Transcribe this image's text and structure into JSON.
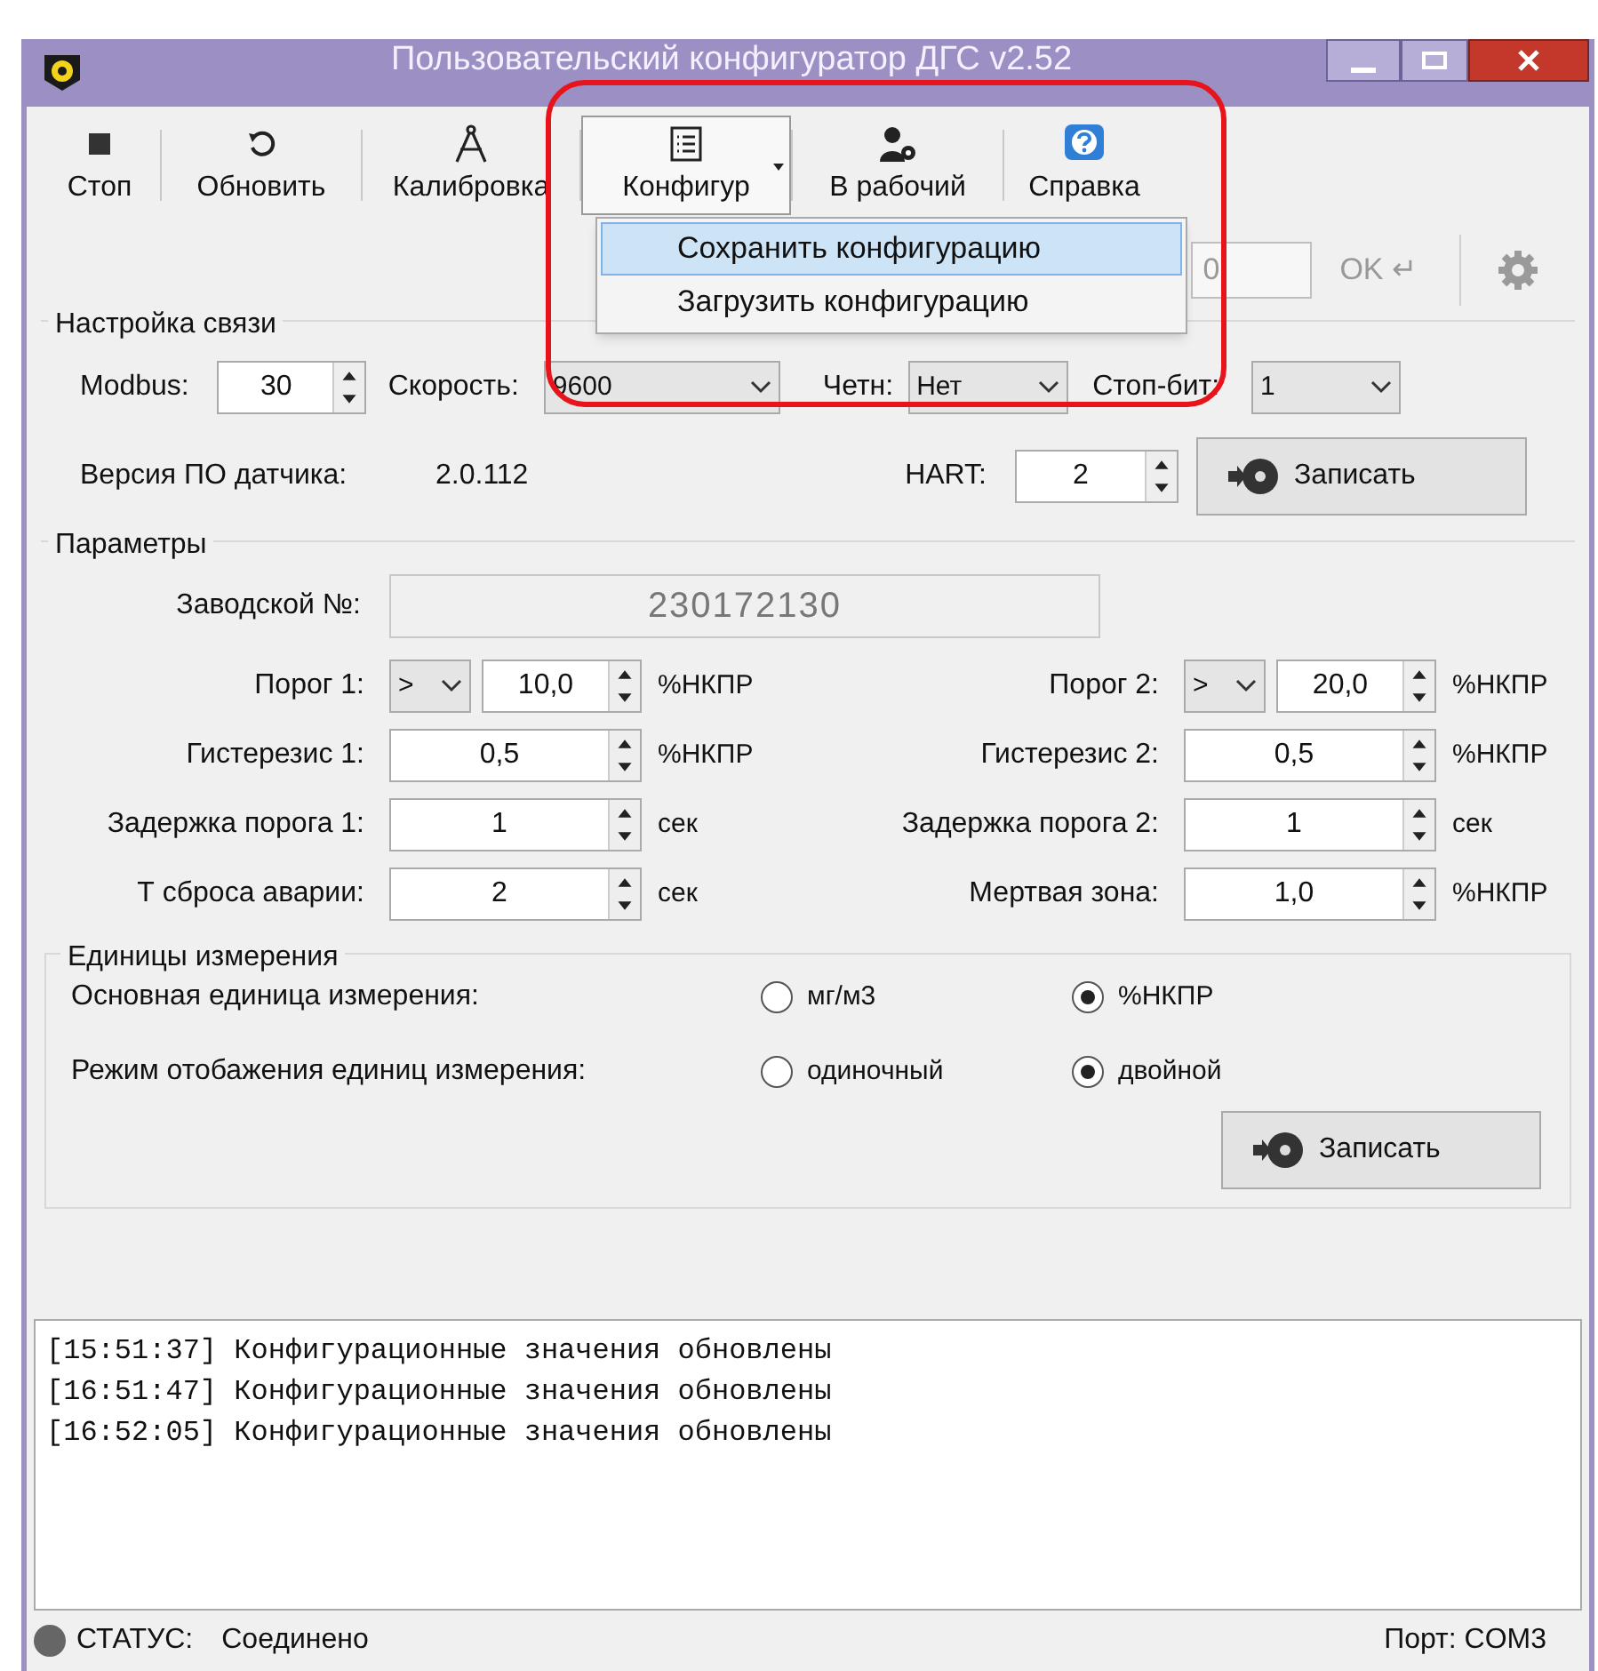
{
  "window": {
    "title": "Пользовательский конфигуратор ДГС v2.52"
  },
  "toolbar": [
    {
      "label": "Стоп",
      "selected": false
    },
    {
      "label": "Обновить",
      "selected": false
    },
    {
      "label": "Калибровка",
      "selected": false
    },
    {
      "label": "Конфигур",
      "selected": true,
      "dropdown": true
    },
    {
      "label": "В рабочий",
      "selected": false
    },
    {
      "label": "Справка",
      "selected": false
    }
  ],
  "config_menu": [
    {
      "label": "Сохранить конфигурацию",
      "selected": true
    },
    {
      "label": "Загрузить конфигурацию",
      "selected": false
    }
  ],
  "command_row": {
    "value": "0",
    "ok": "OK ↵",
    "disabled": true
  },
  "connection": {
    "title": "Настройка связи",
    "modbus_label": "Modbus:",
    "modbus": "30",
    "speed_label": "Скорость:",
    "speed": "9600",
    "parity_label": "Четн:",
    "parity": "Нет",
    "stop_label": "Стоп-бит:",
    "stop": "1",
    "version_label": "Версия ПО датчика:",
    "version": "2.0.112",
    "hart_label": "HART:",
    "hart": "2",
    "write": "Записать"
  },
  "parameters": {
    "title": "Параметры",
    "serial_label": "Заводской №:",
    "serial": "230172130",
    "rows": [
      [
        {
          "label": "Порог 1:",
          "compare": ">",
          "value": "10,0",
          "unit": "%НКПР"
        },
        {
          "label": "Порог 2:",
          "compare": ">",
          "value": "20,0",
          "unit": "%НКПР"
        }
      ],
      [
        {
          "label": "Гистерезис 1:",
          "value": "0,5",
          "unit": "%НКПР"
        },
        {
          "label": "Гистерезис 2:",
          "value": "0,5",
          "unit": "%НКПР"
        }
      ],
      [
        {
          "label": "Задержка порога 1:",
          "value": "1",
          "unit": "сек"
        },
        {
          "label": "Задержка порога 2:",
          "value": "1",
          "unit": "сек"
        }
      ],
      [
        {
          "label": "Т сброса аварии:",
          "value": "2",
          "unit": "сек"
        },
        {
          "label": "Мертвая зона:",
          "value": "1,0",
          "unit": "%НКПР"
        }
      ]
    ]
  },
  "units": {
    "title": "Единицы измерения",
    "rows": [
      {
        "label": "Основная единица измерения:",
        "options": [
          {
            "label": "мг/м3",
            "selected": false
          },
          {
            "label": "%НКПР",
            "selected": true
          }
        ]
      },
      {
        "label": "Режим отобажения единиц измерения:",
        "options": [
          {
            "label": "одиночный",
            "selected": false
          },
          {
            "label": "двойной",
            "selected": true
          }
        ]
      }
    ],
    "write": "Записать"
  },
  "log": [
    "[15:51:37] Конфигурационные значения обновлены",
    "[16:51:47] Конфигурационные значения обновлены",
    "[16:52:05] Конфигурационные значения обновлены"
  ],
  "status_bar": {
    "label": "СТАТУС:",
    "status": "Соединено",
    "port": "Порт: COM3"
  }
}
